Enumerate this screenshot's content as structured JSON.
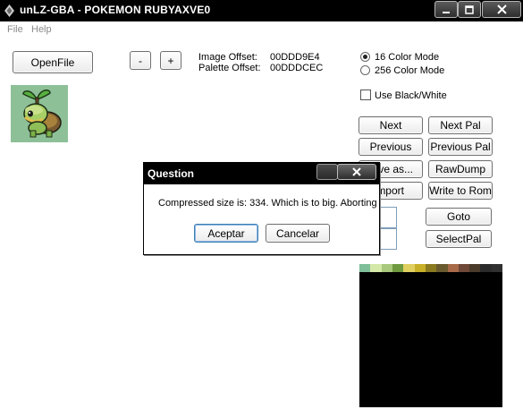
{
  "window": {
    "title": "unLZ-GBA - POKEMON RUBYAXVE0"
  },
  "menu": {
    "file": "File",
    "help": "Help"
  },
  "toolbar": {
    "open_file": "OpenFile",
    "minus": "-",
    "plus": "+"
  },
  "offsets": {
    "image_label": "Image Offset:",
    "image_value": "00DDD9E4",
    "palette_label": "Palette Offset:",
    "palette_value": "00DDDCEC"
  },
  "modes": {
    "color16": "16 Color Mode",
    "color256": "256 Color Mode",
    "selected": "color16",
    "black_white": "Use Black/White",
    "black_white_checked": false
  },
  "buttons": {
    "next": "Next",
    "next_pal": "Next Pal",
    "previous": "Previous",
    "previous_pal": "Previous Pal",
    "save_as": "ve as...",
    "raw_dump": "RawDump",
    "import": "mport",
    "write_to_rom": "Write to Rom",
    "goto": "Goto",
    "select_pal": "SelectPal"
  },
  "palette_colors": [
    "#7fbf9a",
    "#d4e8a8",
    "#a8c87c",
    "#6f9a40",
    "#e0d060",
    "#c8b028",
    "#8a7a20",
    "#6a5a30",
    "#a86a48",
    "#704838",
    "#4a3a2a",
    "#2a2a2a",
    "#303030"
  ],
  "dialog": {
    "title": "Question",
    "message": "Compressed size is: 334. Which is to big. Aborting",
    "accept": "Aceptar",
    "cancel": "Cancelar"
  }
}
